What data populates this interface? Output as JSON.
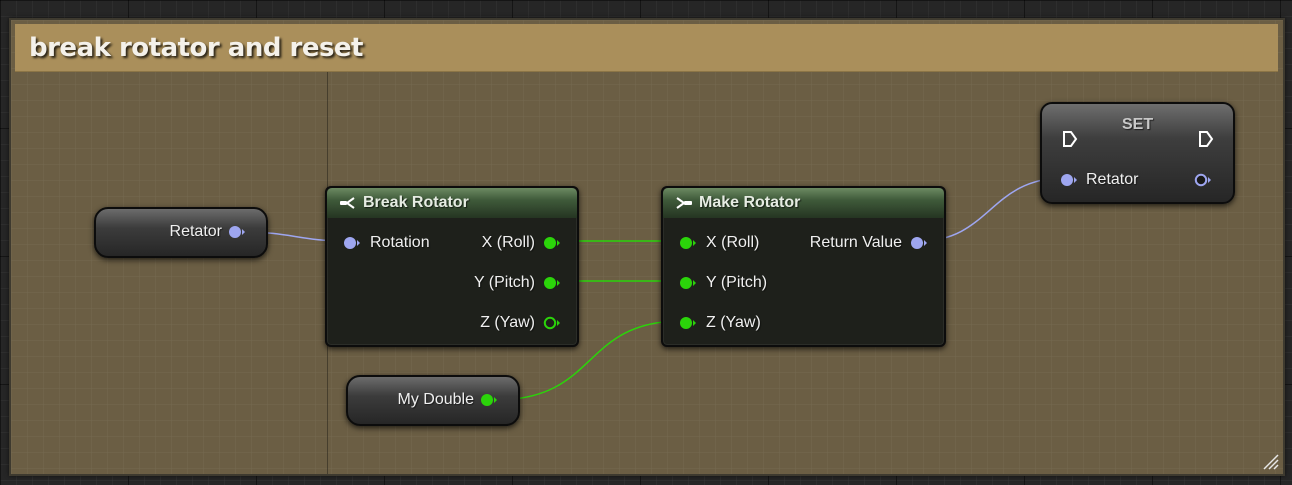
{
  "comment": {
    "title": "break rotator and reset"
  },
  "retator_get": {
    "label": "Retator"
  },
  "break_rotator": {
    "title": "Break Rotator",
    "input": "Rotation",
    "outputs": [
      "X (Roll)",
      "Y (Pitch)",
      "Z (Yaw)"
    ]
  },
  "make_rotator": {
    "title": "Make Rotator",
    "inputs": [
      "X (Roll)",
      "Y (Pitch)",
      "Z (Yaw)"
    ],
    "output": "Return Value"
  },
  "my_double": {
    "label": "My Double"
  },
  "set_node": {
    "title": "SET",
    "pin_label": "Retator"
  },
  "colors": {
    "rotator_pin": "#9ea6f0",
    "float_pin": "#2bd40a",
    "comment_header": "#aa8f5b",
    "comment_body": "#6b5e44",
    "pure_node_header": "#3f5a3a"
  },
  "icons": {
    "break_icon": "break-struct-icon",
    "make_icon": "make-struct-icon",
    "exec_pin": "exec-pin-icon",
    "resize": "resize-grip-icon"
  }
}
